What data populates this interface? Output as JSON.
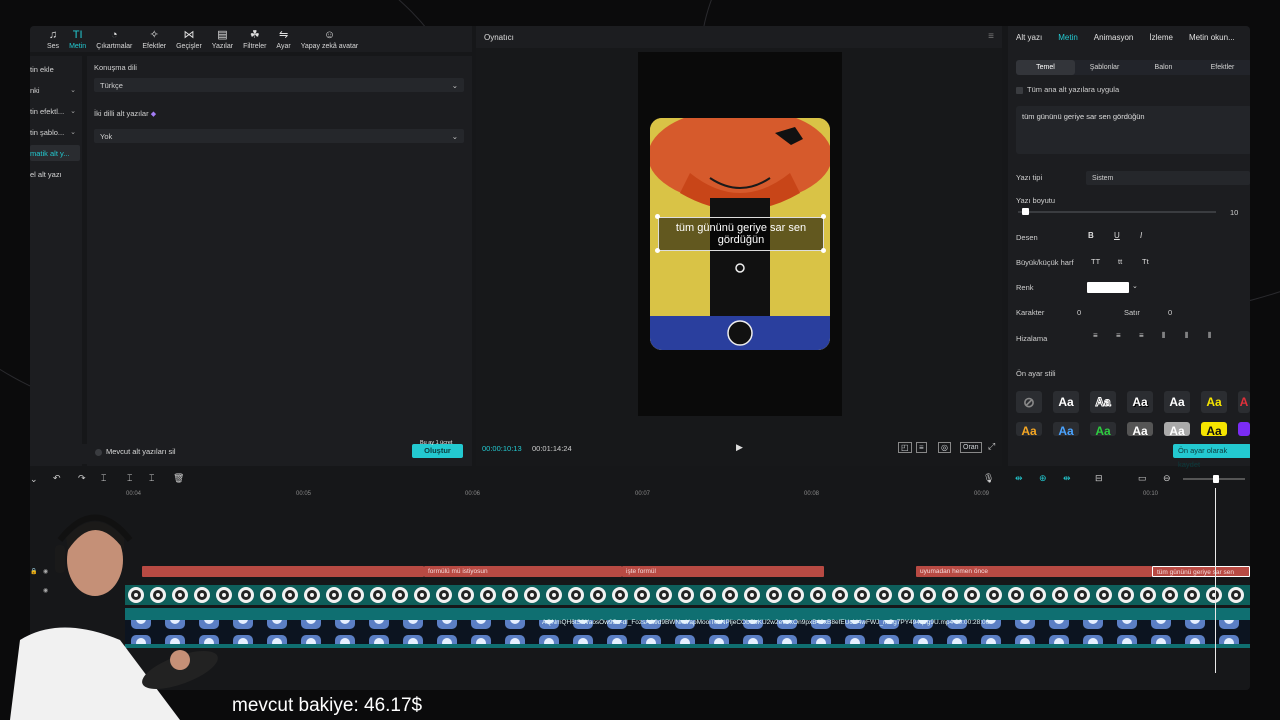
{
  "toolbar": {
    "items": [
      {
        "label": "Ses",
        "icon": "music-note-icon"
      },
      {
        "label": "Metin",
        "icon": "text-icon"
      },
      {
        "label": "Çıkartmalar",
        "icon": "sticker-icon"
      },
      {
        "label": "Efektler",
        "icon": "sparkle-icon"
      },
      {
        "label": "Geçişler",
        "icon": "transition-icon"
      },
      {
        "label": "Yazılar",
        "icon": "caption-icon"
      },
      {
        "label": "Filtreler",
        "icon": "filter-icon"
      },
      {
        "label": "Ayar",
        "icon": "adjust-icon"
      },
      {
        "label": "Yapay zekâ avatar",
        "icon": "avatar-icon"
      }
    ],
    "active": "Metin"
  },
  "leftnav": {
    "items": [
      {
        "label": "tin ekle"
      },
      {
        "label": "nki"
      },
      {
        "label": "tin efektl..."
      },
      {
        "label": "tin şablo..."
      },
      {
        "label": "matik alt y...",
        "active": true
      },
      {
        "label": "el alt yazı"
      }
    ]
  },
  "leftpanel": {
    "speech_label": "Konuşma dili",
    "speech_value": "Türkçe",
    "bilingual_label": "İki dilli alt yazılar",
    "bilingual_value": "Yok",
    "delete_existing": "Mevcut alt yazıları sil",
    "create_button": "Oluştur",
    "credit_note": "Bu ay 1 ücret"
  },
  "player": {
    "title": "Oynatıcı",
    "caption": "tüm gününü geriye sar sen gördüğün",
    "time_current": "00:00:10:13",
    "time_total": "00:01:14:24",
    "ratio_label": "Oran"
  },
  "rightpanel": {
    "tabs": [
      "Alt yazı",
      "Metin",
      "Animasyon",
      "İzleme",
      "Metin okun..."
    ],
    "active_tab": "Metin",
    "subtabs": [
      "Temel",
      "Şablonlar",
      "Balon",
      "Efektler"
    ],
    "active_subtab": "Temel",
    "apply_all": "Tüm ana alt yazılara uygula",
    "text_value": "tüm gününü geriye sar sen gördüğün",
    "font_label": "Yazı tipi",
    "font_value": "Sistem",
    "size_label": "Yazı boyutu",
    "size_value": "10",
    "size_fraction": 0.02,
    "pattern_label": "Desen",
    "case_label": "Büyük/küçük harf",
    "case_options": [
      "TT",
      "tt",
      "Tt"
    ],
    "color_label": "Renk",
    "color_value": "#ffffff",
    "char_label": "Karakter",
    "char_value": "0",
    "line_label": "Satır",
    "line_value": "0",
    "align_label": "Hizalama",
    "preset_label": "Ön ayar stili",
    "preset_sample": "Aa",
    "save_preset": "Ön ayar olarak kaydet"
  },
  "timeline": {
    "ruler": [
      "00:04",
      "00:05",
      "00:06",
      "00:07",
      "00:08",
      "00:09",
      "00:10"
    ],
    "text_clips": [
      {
        "label": "formülü mü istiyosun"
      },
      {
        "label": "işte formül"
      },
      {
        "label": "uyumadan hemen önce"
      },
      {
        "label": "tüm gününü geriye sar sen"
      }
    ],
    "video_file": "AQNmQH6tSfWaosOw9Su-dl_FozsAA9d9BWNmYapMooiTekNPljeCObSbKU2w2evVxOn9pxB43xB8efEUcLi4wFWJ_mCg7PY494qzg9U.mp4",
    "video_duration": "00:00:28:06"
  },
  "overlay": {
    "balance": "mevcut bakiye: 46.17$"
  },
  "colors": {
    "accent": "#23c9d0",
    "text_clip": "#b84a43",
    "video_track": "#0f6f71"
  }
}
